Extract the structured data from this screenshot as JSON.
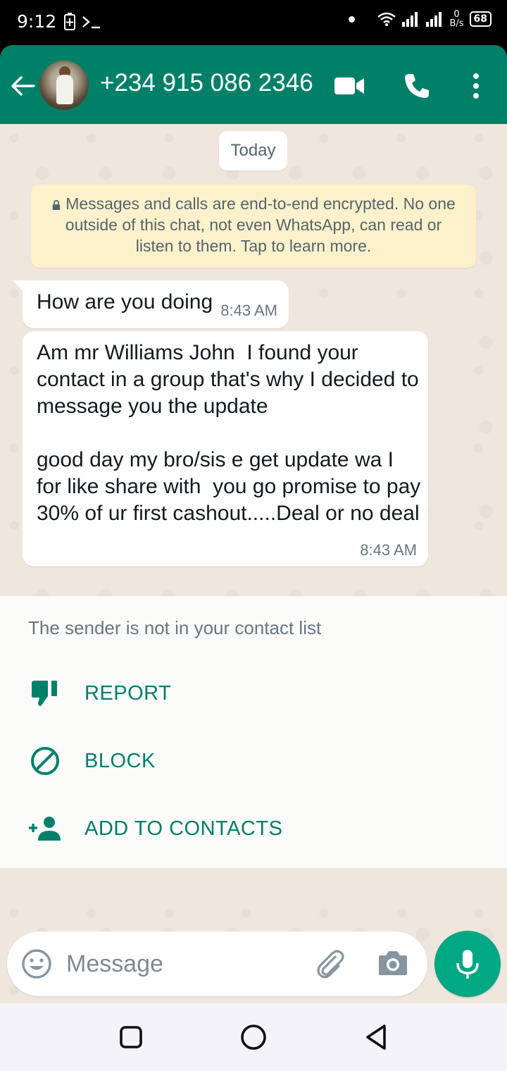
{
  "status_bar": {
    "time": "9:12",
    "speed_value": "0",
    "speed_unit": "B/s",
    "battery": "68"
  },
  "header": {
    "contact": "+234 915 086 2346",
    "accent_color": "#008069"
  },
  "chat": {
    "date_chip": "Today",
    "encryption_notice": "Messages and calls are end-to-end encrypted. No one outside of this chat, not even WhatsApp, can read or listen to them. Tap to learn more.",
    "messages": [
      {
        "text": "How are you doing",
        "time": "8:43 AM"
      },
      {
        "text": "Am mr Williams John  I found your contact in a group that's why I decided to message you the update\n\ngood day my bro/sis e get update wa I for like share with  you go promise to pay 30% of ur first cashout.....Deal or no deal",
        "time": "8:43 AM"
      }
    ]
  },
  "unknown_sender": {
    "note": "The sender is not in your contact list",
    "actions": [
      {
        "label": "REPORT",
        "icon": "thumbs-down-icon"
      },
      {
        "label": "BLOCK",
        "icon": "block-icon"
      },
      {
        "label": "ADD TO CONTACTS",
        "icon": "add-person-icon"
      }
    ]
  },
  "composer": {
    "placeholder": "Message"
  }
}
